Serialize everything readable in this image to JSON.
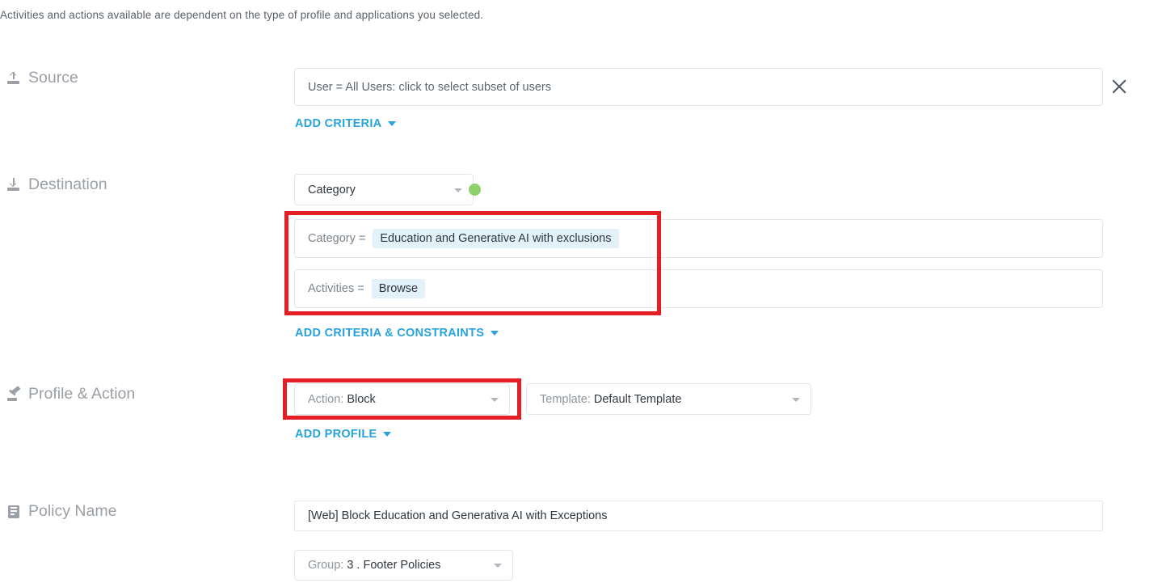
{
  "page": {
    "helper_text": "Activities and actions available are dependent on the type of profile and applications you selected."
  },
  "source": {
    "label": "Source",
    "icon": "upload-icon",
    "criteria_value": "User = All Users: click to select subset of users",
    "add_criteria_label": "ADD CRITERIA",
    "remove_label": "close-icon"
  },
  "destination": {
    "label": "Destination",
    "icon": "download-icon",
    "type_select": {
      "value": "Category",
      "status_dot_color": "#8ed16b"
    },
    "criteria": [
      {
        "key": "Category =",
        "chip": "Education and Generative AI with exclusions"
      },
      {
        "key": "Activities =",
        "chip": "Browse"
      }
    ],
    "add_criteria_label": "ADD CRITERIA & CONSTRAINTS"
  },
  "profile_action": {
    "label": "Profile & Action",
    "icon": "gavel-icon",
    "action_select": {
      "prefix": "Action:",
      "value": "Block"
    },
    "template_select": {
      "prefix": "Template:",
      "value": "Default Template"
    },
    "add_profile_label": "ADD PROFILE"
  },
  "policy_name": {
    "label": "Policy Name",
    "icon": "document-icon",
    "name_value": "[Web] Block Education and Generativa AI with Exceptions",
    "group_select": {
      "prefix": "Group:",
      "value": "3 . Footer Policies"
    }
  },
  "annotations": {
    "highlight_color": "#e31e24",
    "boxes": [
      {
        "name": "destination-criteria-highlight"
      },
      {
        "name": "action-select-highlight"
      }
    ]
  },
  "theme": {
    "link_color": "#29a3db",
    "chip_bg": "#e2f1fa",
    "label_color": "#9aa0a6"
  }
}
